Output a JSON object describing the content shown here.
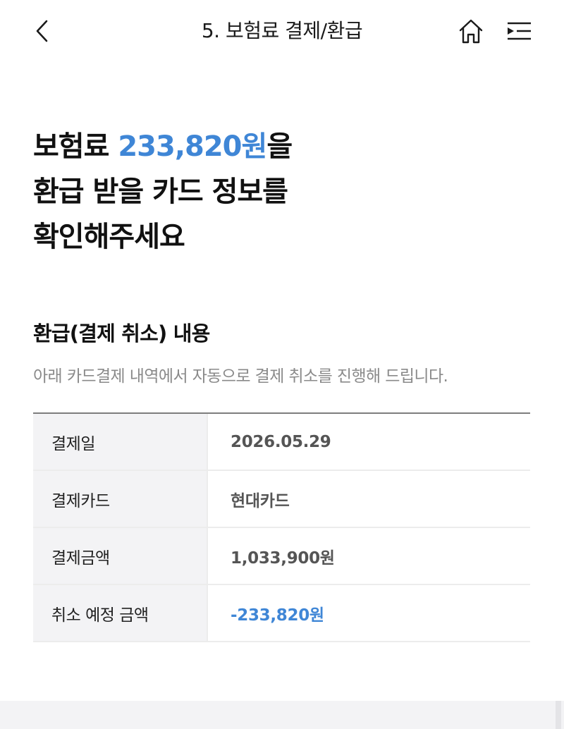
{
  "header": {
    "title": "5. 보험료 결제/환급",
    "back_icon": "chevron-left-icon",
    "home_icon": "home-icon",
    "menu_icon": "menu-icon"
  },
  "headline": {
    "line1_prefix": "보험료 ",
    "line1_amount": "233,820원",
    "line1_suffix": "을",
    "line2": "환급 받을 카드 정보를",
    "line3": "확인해주세요"
  },
  "section": {
    "title": "환급(결제 취소) 내용",
    "description": "아래 카드결제 내역에서 자동으로 결제 취소를 진행해 드립니다."
  },
  "table": {
    "rows": [
      {
        "label": "결제일",
        "value": "2026.05.29"
      },
      {
        "label": "결제카드",
        "value": "현대카드"
      },
      {
        "label": "결제금액",
        "value": "1,033,900원"
      },
      {
        "label": "취소 예정 금액",
        "value": "-233,820원"
      }
    ]
  },
  "colors": {
    "accent": "#3f86d6",
    "label_bg": "#f3f3f5",
    "muted_text": "#8a8a8a"
  }
}
